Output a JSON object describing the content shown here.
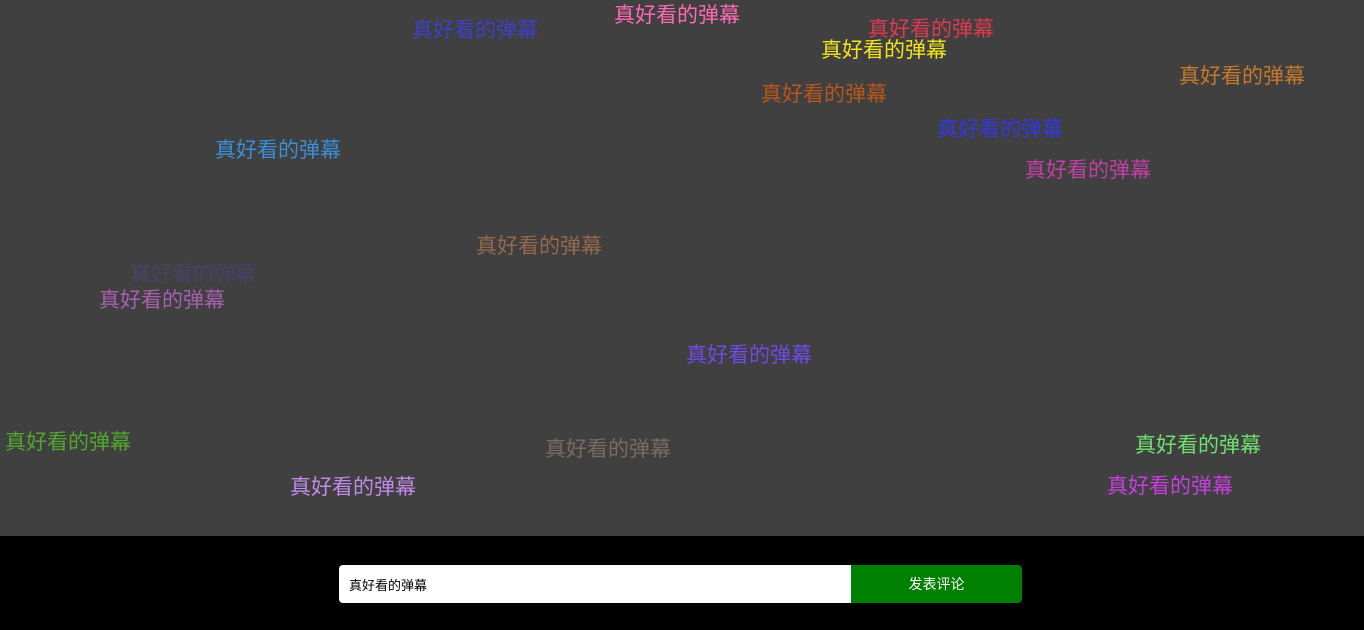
{
  "danmaku": {
    "items": [
      {
        "text": "真好看的弹幕",
        "color": "#ff69b4"
      },
      {
        "text": "真好看的弹幕",
        "color": "#3f3fc8"
      },
      {
        "text": "真好看的弹幕",
        "color": "#e0394f"
      },
      {
        "text": "真好看的弹幕",
        "color": "#f2e31a"
      },
      {
        "text": "真好看的弹幕",
        "color": "#c8782a"
      },
      {
        "text": "真好看的弹幕",
        "color": "#b8571a"
      },
      {
        "text": "真好看的弹幕",
        "color": "#3338e0"
      },
      {
        "text": "真好看的弹幕",
        "color": "#3a8fd8"
      },
      {
        "text": "真好看的弹幕",
        "color": "#c23fa4"
      },
      {
        "text": "真好看的弹幕",
        "color": "#96684a"
      },
      {
        "text": "真好看的弹幕",
        "color": "#4a4068"
      },
      {
        "text": "真好看的弹幕",
        "color": "#a85fb0"
      },
      {
        "text": "真好看的弹幕",
        "color": "#6f4ae8"
      },
      {
        "text": "真好看的弹幕",
        "color": "#4fa82c"
      },
      {
        "text": "真好看的弹幕",
        "color": "#7a6a62"
      },
      {
        "text": "真好看的弹幕",
        "color": "#6ee06e"
      },
      {
        "text": "真好看的弹幕",
        "color": "#c08ae8"
      },
      {
        "text": "真好看的弹幕",
        "color": "#c83fe0"
      }
    ]
  },
  "composer": {
    "input_value": "真好看的弹幕",
    "send_label": "发表评论",
    "button_color": "#008000"
  }
}
